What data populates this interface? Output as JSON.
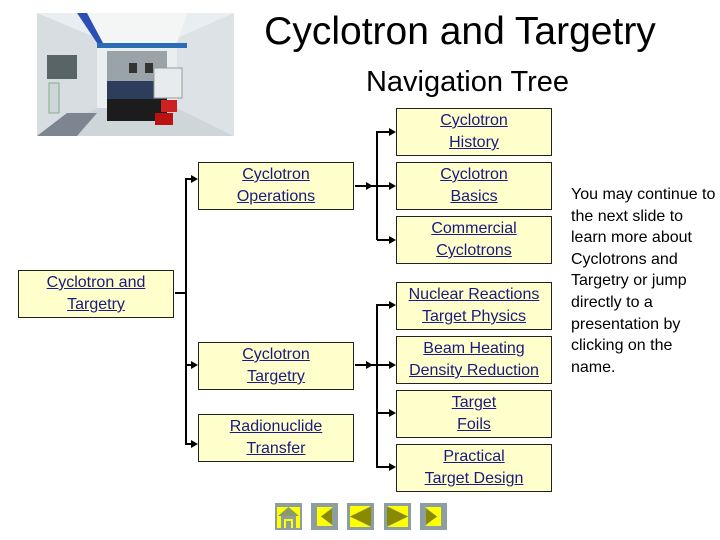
{
  "header": {
    "title": "Cyclotron and Targetry",
    "subtitle": "Navigation Tree",
    "photo": "cyclotron-facility-photo"
  },
  "tree": {
    "root": {
      "line1": "Cyclotron and",
      "line2": "Targetry"
    },
    "level1": [
      {
        "line1": "Cyclotron",
        "line2": "Operations"
      },
      {
        "line1": "Cyclotron",
        "line2": "Targetry"
      },
      {
        "line1": "Radionuclide",
        "line2": "Transfer"
      }
    ],
    "operations_children": [
      {
        "line1": "Cyclotron",
        "line2": "History"
      },
      {
        "line1": "Cyclotron",
        "line2": "Basics"
      },
      {
        "line1": "Commercial",
        "line2": "Cyclotrons"
      }
    ],
    "targetry_children": [
      {
        "line1": "Nuclear Reactions",
        "line2": "Target Physics"
      },
      {
        "line1": "Beam Heating",
        "line2": "Density Reduction"
      },
      {
        "line1": "Target",
        "line2": "Foils"
      },
      {
        "line1": "Practical",
        "line2": "Target Design"
      }
    ]
  },
  "note": "You may continue to the next slide to learn more about Cyclotrons and Targetry or jump directly to a presentation by clicking on the name.",
  "nav": {
    "buttons": [
      {
        "icon": "home-icon",
        "label": "Home"
      },
      {
        "icon": "first-slide-icon",
        "label": "First"
      },
      {
        "icon": "previous-slide-icon",
        "label": "Previous"
      },
      {
        "icon": "next-slide-icon",
        "label": "Next"
      },
      {
        "icon": "last-slide-icon",
        "label": "Last"
      }
    ]
  },
  "colors": {
    "node_fill": "#ffffcc",
    "link_text": "#1a1a80",
    "nav_button_bg": "#8c9ea0",
    "nav_accent": "#ffff00",
    "nav_glyph": "#8a8a00"
  }
}
